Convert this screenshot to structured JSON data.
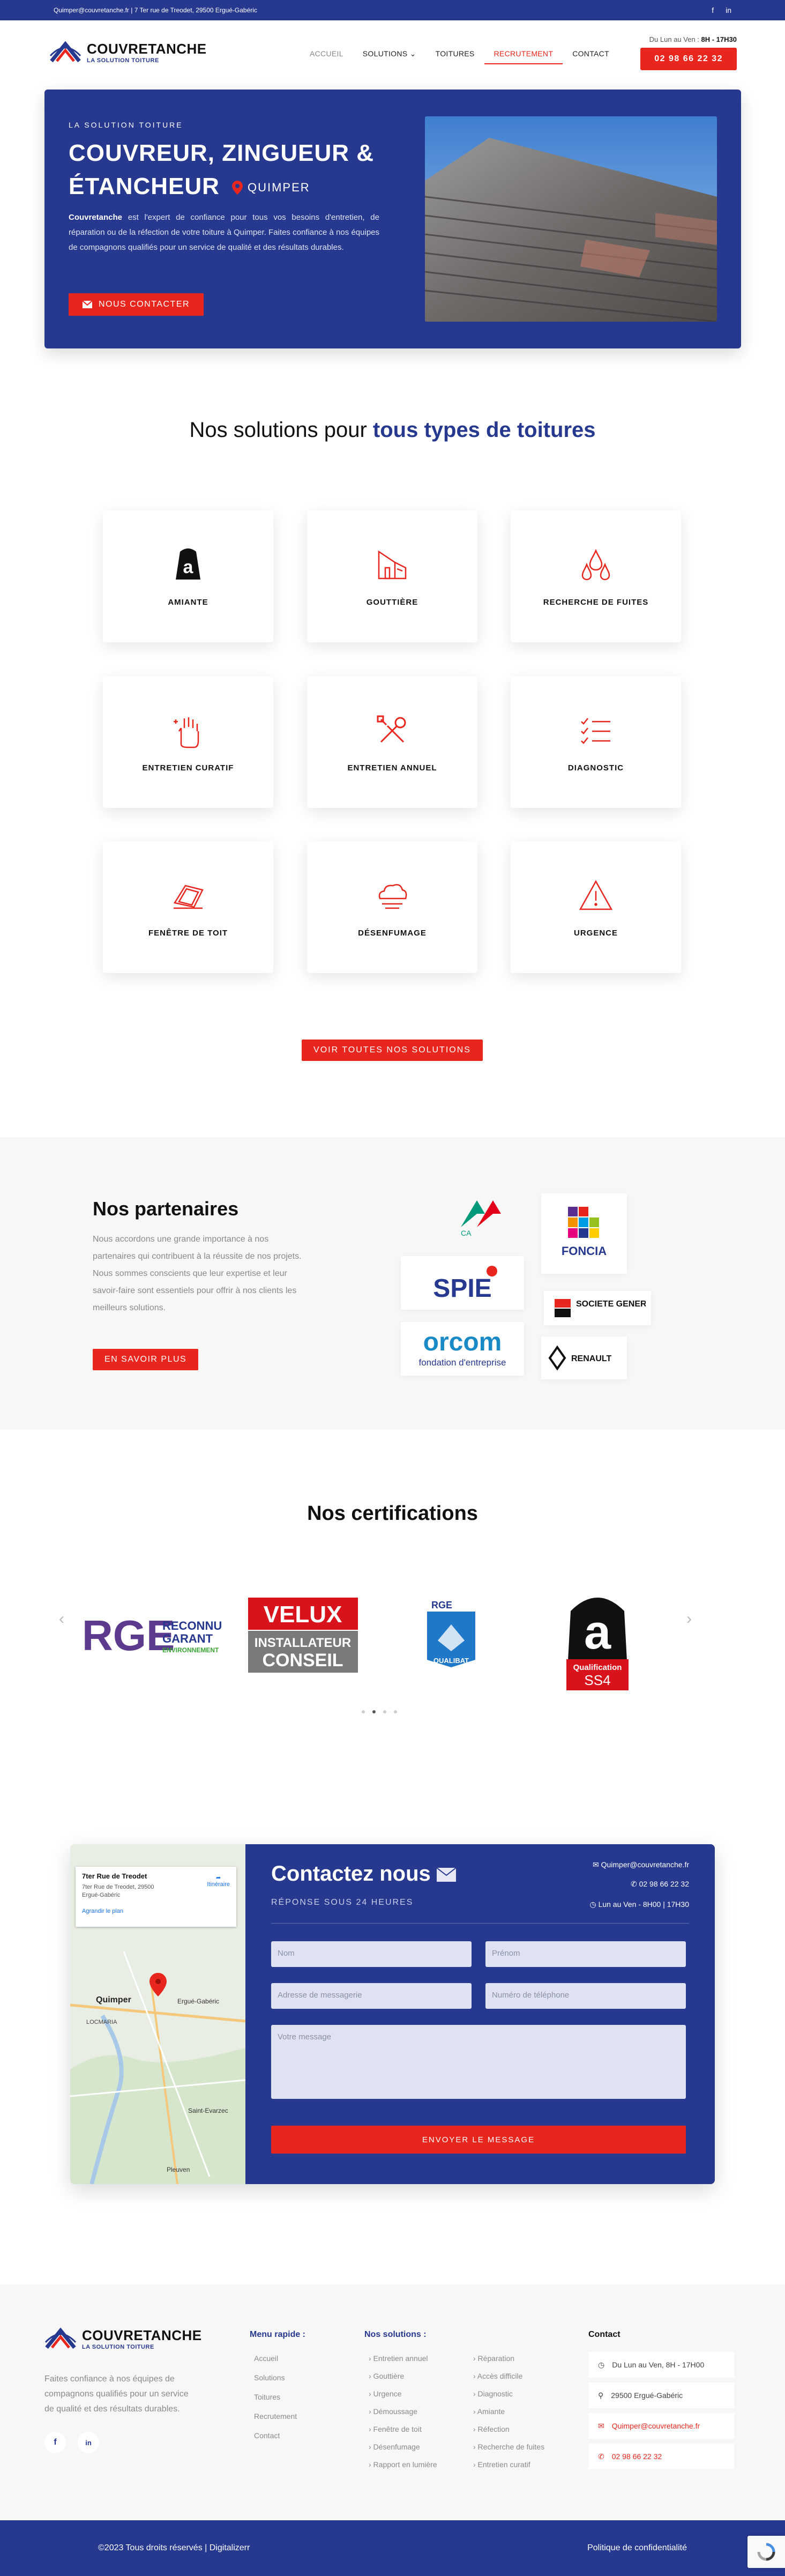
{
  "topbar": {
    "contact_line": "Quimper@couvretanche.fr  |  7 Ter rue de Treodet, 29500 Ergué-Gabéric",
    "social": [
      "f",
      "in"
    ]
  },
  "header": {
    "logo_name": "COUVRETANCHE",
    "logo_tag": "LA SOLUTION TOITURE",
    "nav": [
      {
        "label": "ACCUEIL"
      },
      {
        "label": "SOLUTIONS ⌄"
      },
      {
        "label": "TOITURES"
      },
      {
        "label": "RECRUTEMENT"
      },
      {
        "label": "CONTACT"
      }
    ],
    "hours_prefix": "Du Lun au Ven : ",
    "hours_value": "8H - 17H30",
    "phone": "02 98 66 22 32"
  },
  "hero": {
    "eyebrow": "LA SOLUTION TOITURE",
    "title": "COUVREUR, ZINGUEUR & ÉTANCHEUR",
    "location": "QUIMPER",
    "brand": "Couvretanche",
    "body": " est l'expert de confiance pour tous vos besoins d'entretien, de réparation ou de la réfection de votre toiture à Quimper. Faites confiance à nos équipes de compagnons qualifiés pour un service de qualité et des résultats durables.",
    "cta": "NOUS CONTACTER"
  },
  "solutions": {
    "title_plain": "Nos solutions pour ",
    "title_bold": "tous types de toitures",
    "cards": [
      {
        "label": "AMIANTE",
        "icon": "asbestos-icon"
      },
      {
        "label": "GOUTTIÈRE",
        "icon": "gutter-icon"
      },
      {
        "label": "RECHERCHE DE FUITES",
        "icon": "drops-icon"
      },
      {
        "label": "ENTRETIEN CURATIF",
        "icon": "hand-icon"
      },
      {
        "label": "ENTRETIEN ANNUEL",
        "icon": "tools-icon"
      },
      {
        "label": "DIAGNOSTIC",
        "icon": "checklist-icon"
      },
      {
        "label": "FENÊTRE DE TOIT",
        "icon": "roof-window-icon"
      },
      {
        "label": "DÉSENFUMAGE",
        "icon": "smoke-icon"
      },
      {
        "label": "URGENCE",
        "icon": "warning-icon"
      }
    ],
    "all_button": "VOIR TOUTES NOS SOLUTIONS"
  },
  "partners": {
    "title": "Nos partenaires",
    "body": "Nous accordons une grande importance à nos partenaires qui contribuent à la réussite de nos projets. Nous sommes conscients que leur expertise et leur savoir-faire sont essentiels pour offrir à nos clients les meilleurs solutions.",
    "button": "EN SAVOIR PLUS",
    "logos": [
      "CA",
      "FONCIA",
      "SPIE",
      "SOCIETE GENERALE",
      "orcom",
      "fondation d'entreprise",
      "RENAULT"
    ]
  },
  "certifications": {
    "title": "Nos certifications",
    "rge_line1": "RECONNU",
    "rge_line2": "GARANT",
    "rge_line3": "ENVIRONNEMENT",
    "velux_brand": "VELUX",
    "velux_sub1": "INSTALLATEUR",
    "velux_sub2": "CONSEIL",
    "qualibat": "QUALIBAT",
    "ss4_line1": "Qualification",
    "ss4_line2": "SS4"
  },
  "contact": {
    "map_title": "7ter Rue de Treodet",
    "map_address": "7ter Rue de Treodet, 29500 Ergué-Gabéric",
    "map_link": "Agrandir le plan",
    "map_dir": "Itinéraire",
    "map_city1": "Quimper",
    "map_city2": "Ergué-Gabéric",
    "map_city3": "Saint-Evarzec",
    "map_city4": "Pleuven",
    "map_city5": "LOCMARIA",
    "title": "Contactez nous",
    "subtitle": "RÉPONSE SOUS 24 HEURES",
    "email": "Quimper@couvretanche.fr",
    "phone": "02 98 66 22 32",
    "hours": "Lun au Ven - 8H00 | 17H30",
    "placeholders": {
      "name": "Nom",
      "firstname": "Prénom",
      "email": "Adresse de messagerie",
      "phone": "Numéro de téléphone",
      "message": "Votre message"
    },
    "send": "ENVOYER LE MESSAGE"
  },
  "footer": {
    "logo_name": "COUVRETANCHE",
    "logo_tag": "LA SOLUTION TOITURE",
    "desc": "Faites confiance à nos équipes de compagnons qualifiés pour un service de qualité et des résultats durables.",
    "menu_title": "Menu rapide :",
    "menu": [
      "Accueil",
      "Solutions",
      "Toitures",
      "Recrutement",
      "Contact"
    ],
    "sol_title": "Nos solutions :",
    "sol_col1": [
      "› Entretien annuel",
      "› Gouttière",
      "› Urgence",
      "› Démoussage",
      "› Fenêtre de toit",
      "› Désenfumage",
      "› Rapport en lumière"
    ],
    "sol_col2": [
      "› Réparation",
      "› Accès difficile",
      "› Diagnostic",
      "› Amiante",
      "› Réfection",
      "› Recherche de fuites",
      "› Entretien curatif"
    ],
    "contact_title": "Contact",
    "contact_hours": "Du Lun au Ven, 8H - 17H00",
    "contact_addr": "29500 Ergué-Gabéric",
    "contact_email": "Quimper@couvretanche.fr",
    "contact_phone": "02 98 66 22 32",
    "copyright": "©2023 Tous droits réservés | Digitalizerr",
    "privacy": "Politique de confidentialité"
  },
  "colors": {
    "brand_blue": "#27388f",
    "accent_red": "#e8261e"
  }
}
